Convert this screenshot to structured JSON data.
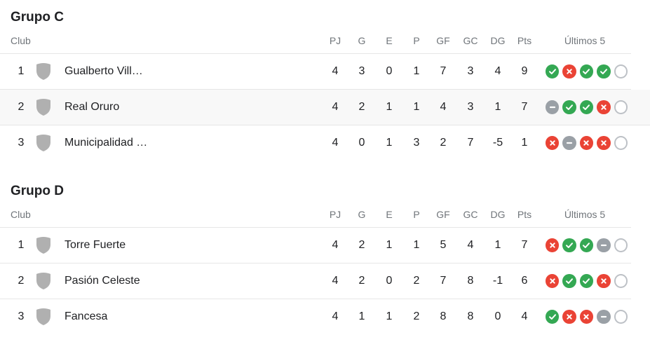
{
  "columns": {
    "club": "Club",
    "pj": "PJ",
    "g": "G",
    "e": "E",
    "p": "P",
    "gf": "GF",
    "gc": "GC",
    "dg": "DG",
    "pts": "Pts",
    "last5": "Últimos 5"
  },
  "colors": {
    "win": "#34a853",
    "loss": "#ea4335",
    "draw": "#9aa0a6",
    "upcoming": "#bdc1c6",
    "crest": "#b0b0b0"
  },
  "groups": [
    {
      "title": "Grupo C",
      "rows": [
        {
          "rank": "1",
          "name": "Gualberto Vill…",
          "pj": "4",
          "g": "3",
          "e": "0",
          "p": "1",
          "gf": "7",
          "gc": "3",
          "dg": "4",
          "pts": "9",
          "last5": [
            "W",
            "L",
            "W",
            "W",
            "N"
          ]
        },
        {
          "rank": "2",
          "name": "Real Oruro",
          "pj": "4",
          "g": "2",
          "e": "1",
          "p": "1",
          "gf": "4",
          "gc": "3",
          "dg": "1",
          "pts": "7",
          "last5": [
            "D",
            "W",
            "W",
            "L",
            "N"
          ]
        },
        {
          "rank": "3",
          "name": "Municipalidad …",
          "pj": "4",
          "g": "0",
          "e": "1",
          "p": "3",
          "gf": "2",
          "gc": "7",
          "dg": "-5",
          "pts": "1",
          "last5": [
            "L",
            "D",
            "L",
            "L",
            "N"
          ]
        }
      ]
    },
    {
      "title": "Grupo D",
      "rows": [
        {
          "rank": "1",
          "name": "Torre Fuerte",
          "pj": "4",
          "g": "2",
          "e": "1",
          "p": "1",
          "gf": "5",
          "gc": "4",
          "dg": "1",
          "pts": "7",
          "last5": [
            "L",
            "W",
            "W",
            "D",
            "N"
          ]
        },
        {
          "rank": "2",
          "name": "Pasión Celeste",
          "pj": "4",
          "g": "2",
          "e": "0",
          "p": "2",
          "gf": "7",
          "gc": "8",
          "dg": "-1",
          "pts": "6",
          "last5": [
            "L",
            "W",
            "W",
            "L",
            "N"
          ]
        },
        {
          "rank": "3",
          "name": "Fancesa",
          "pj": "4",
          "g": "1",
          "e": "1",
          "p": "2",
          "gf": "8",
          "gc": "8",
          "dg": "0",
          "pts": "4",
          "last5": [
            "W",
            "L",
            "L",
            "D",
            "N"
          ]
        }
      ]
    }
  ]
}
